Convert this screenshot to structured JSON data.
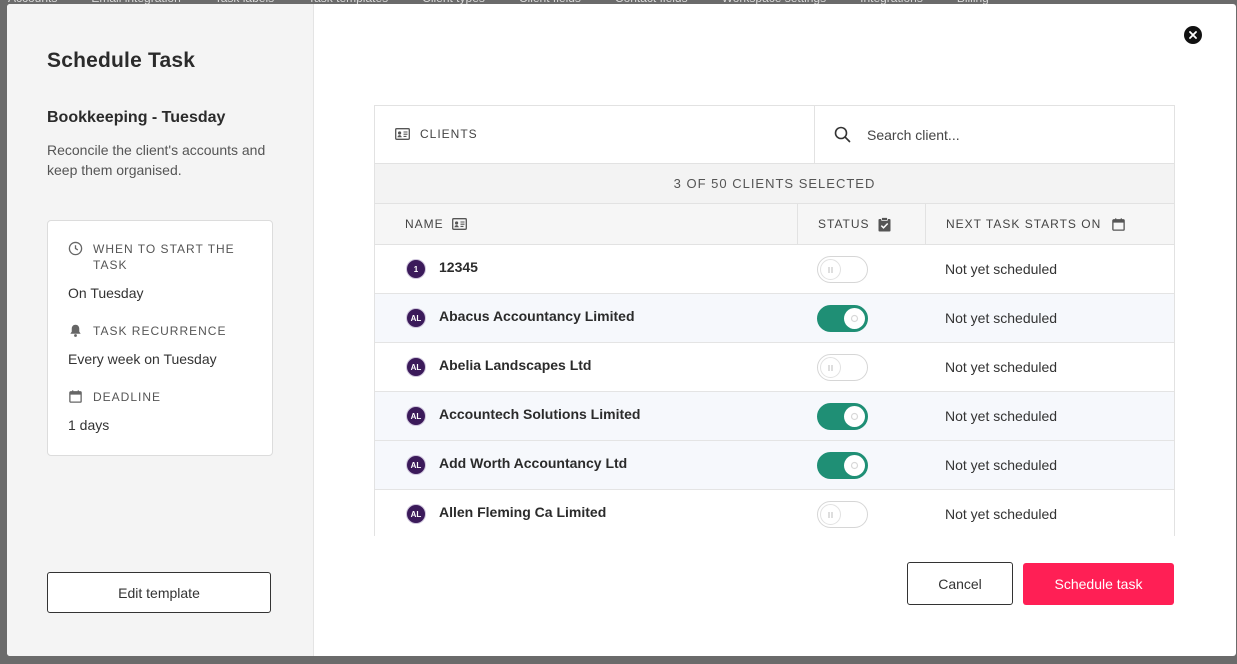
{
  "background_nav": [
    "Accounts",
    "Email integration",
    "Task labels",
    "Task templates",
    "Client types",
    "Client fields",
    "Contact fields",
    "Workspace settings",
    "Integrations",
    "Billing"
  ],
  "sidebar": {
    "title": "Schedule Task",
    "task_name": "Bookkeeping - Tuesday",
    "task_description": "Reconcile the client's accounts and keep them organised.",
    "info": {
      "start_label": "WHEN TO START THE TASK",
      "start_value": "On Tuesday",
      "recurrence_label": "TASK RECURRENCE",
      "recurrence_value": "Every week on Tuesday",
      "deadline_label": "DEADLINE",
      "deadline_value": "1 days"
    },
    "edit_template_label": "Edit template"
  },
  "clients_panel": {
    "header_label": "CLIENTS",
    "search_placeholder": "Search client...",
    "selected_summary": "3 OF 50 CLIENTS SELECTED",
    "columns": {
      "name": "NAME",
      "status": "STATUS",
      "next": "NEXT TASK STARTS ON"
    },
    "rows": [
      {
        "initials": "1",
        "name": "12345",
        "selected": false,
        "next": "Not yet scheduled"
      },
      {
        "initials": "AL",
        "name": "Abacus Accountancy Limited",
        "selected": true,
        "next": "Not yet scheduled"
      },
      {
        "initials": "AL",
        "name": "Abelia Landscapes Ltd",
        "selected": false,
        "next": "Not yet scheduled"
      },
      {
        "initials": "AL",
        "name": "Accountech Solutions Limited",
        "selected": true,
        "next": "Not yet scheduled"
      },
      {
        "initials": "AL",
        "name": "Add Worth Accountancy Ltd",
        "selected": true,
        "next": "Not yet scheduled"
      },
      {
        "initials": "AL",
        "name": "Allen Fleming Ca Limited",
        "selected": false,
        "next": "Not yet scheduled"
      }
    ]
  },
  "footer": {
    "cancel_label": "Cancel",
    "schedule_label": "Schedule task"
  },
  "colors": {
    "accent": "#ff1f55",
    "toggle_on": "#1f8f75",
    "avatar": "#3b1a5a"
  },
  "icons": {
    "close": "close-icon",
    "clock": "clock-icon",
    "bell": "bell-icon",
    "calendar": "calendar-icon",
    "id_card": "id-card-icon",
    "search": "search-icon",
    "clipboard": "clipboard-check-icon"
  }
}
